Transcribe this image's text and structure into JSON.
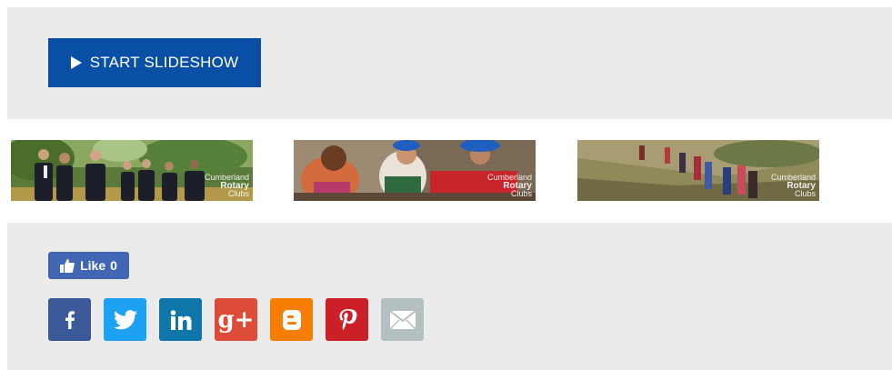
{
  "slideshow": {
    "label": "START SLIDESHOW",
    "icon": "play-icon",
    "bg_color": "#0a4fa6"
  },
  "thumbnails": [
    {
      "watermark_top": "Cumberland",
      "watermark_brand": "Rotary",
      "watermark_bottom": "Clubs"
    },
    {
      "watermark_top": "Cumberland",
      "watermark_brand": "Rotary",
      "watermark_bottom": "Clubs"
    },
    {
      "watermark_top": "Cumberland",
      "watermark_brand": "Rotary",
      "watermark_bottom": "Clubs"
    }
  ],
  "social": {
    "like": {
      "label": "Like",
      "count": "0",
      "color": "#4267b2"
    },
    "share_buttons": [
      {
        "name": "facebook",
        "icon": "facebook-icon",
        "color": "#3b5998"
      },
      {
        "name": "twitter",
        "icon": "twitter-icon",
        "color": "#1da1f2"
      },
      {
        "name": "linkedin",
        "icon": "linkedin-icon",
        "color": "#0e76a8"
      },
      {
        "name": "google-plus",
        "icon": "google-plus-icon",
        "color": "#dd4b39"
      },
      {
        "name": "blogger",
        "icon": "blogger-icon",
        "color": "#f57d00"
      },
      {
        "name": "pinterest",
        "icon": "pinterest-icon",
        "color": "#cb2027"
      },
      {
        "name": "email",
        "icon": "email-icon",
        "color": "#b4bfbf"
      }
    ]
  }
}
